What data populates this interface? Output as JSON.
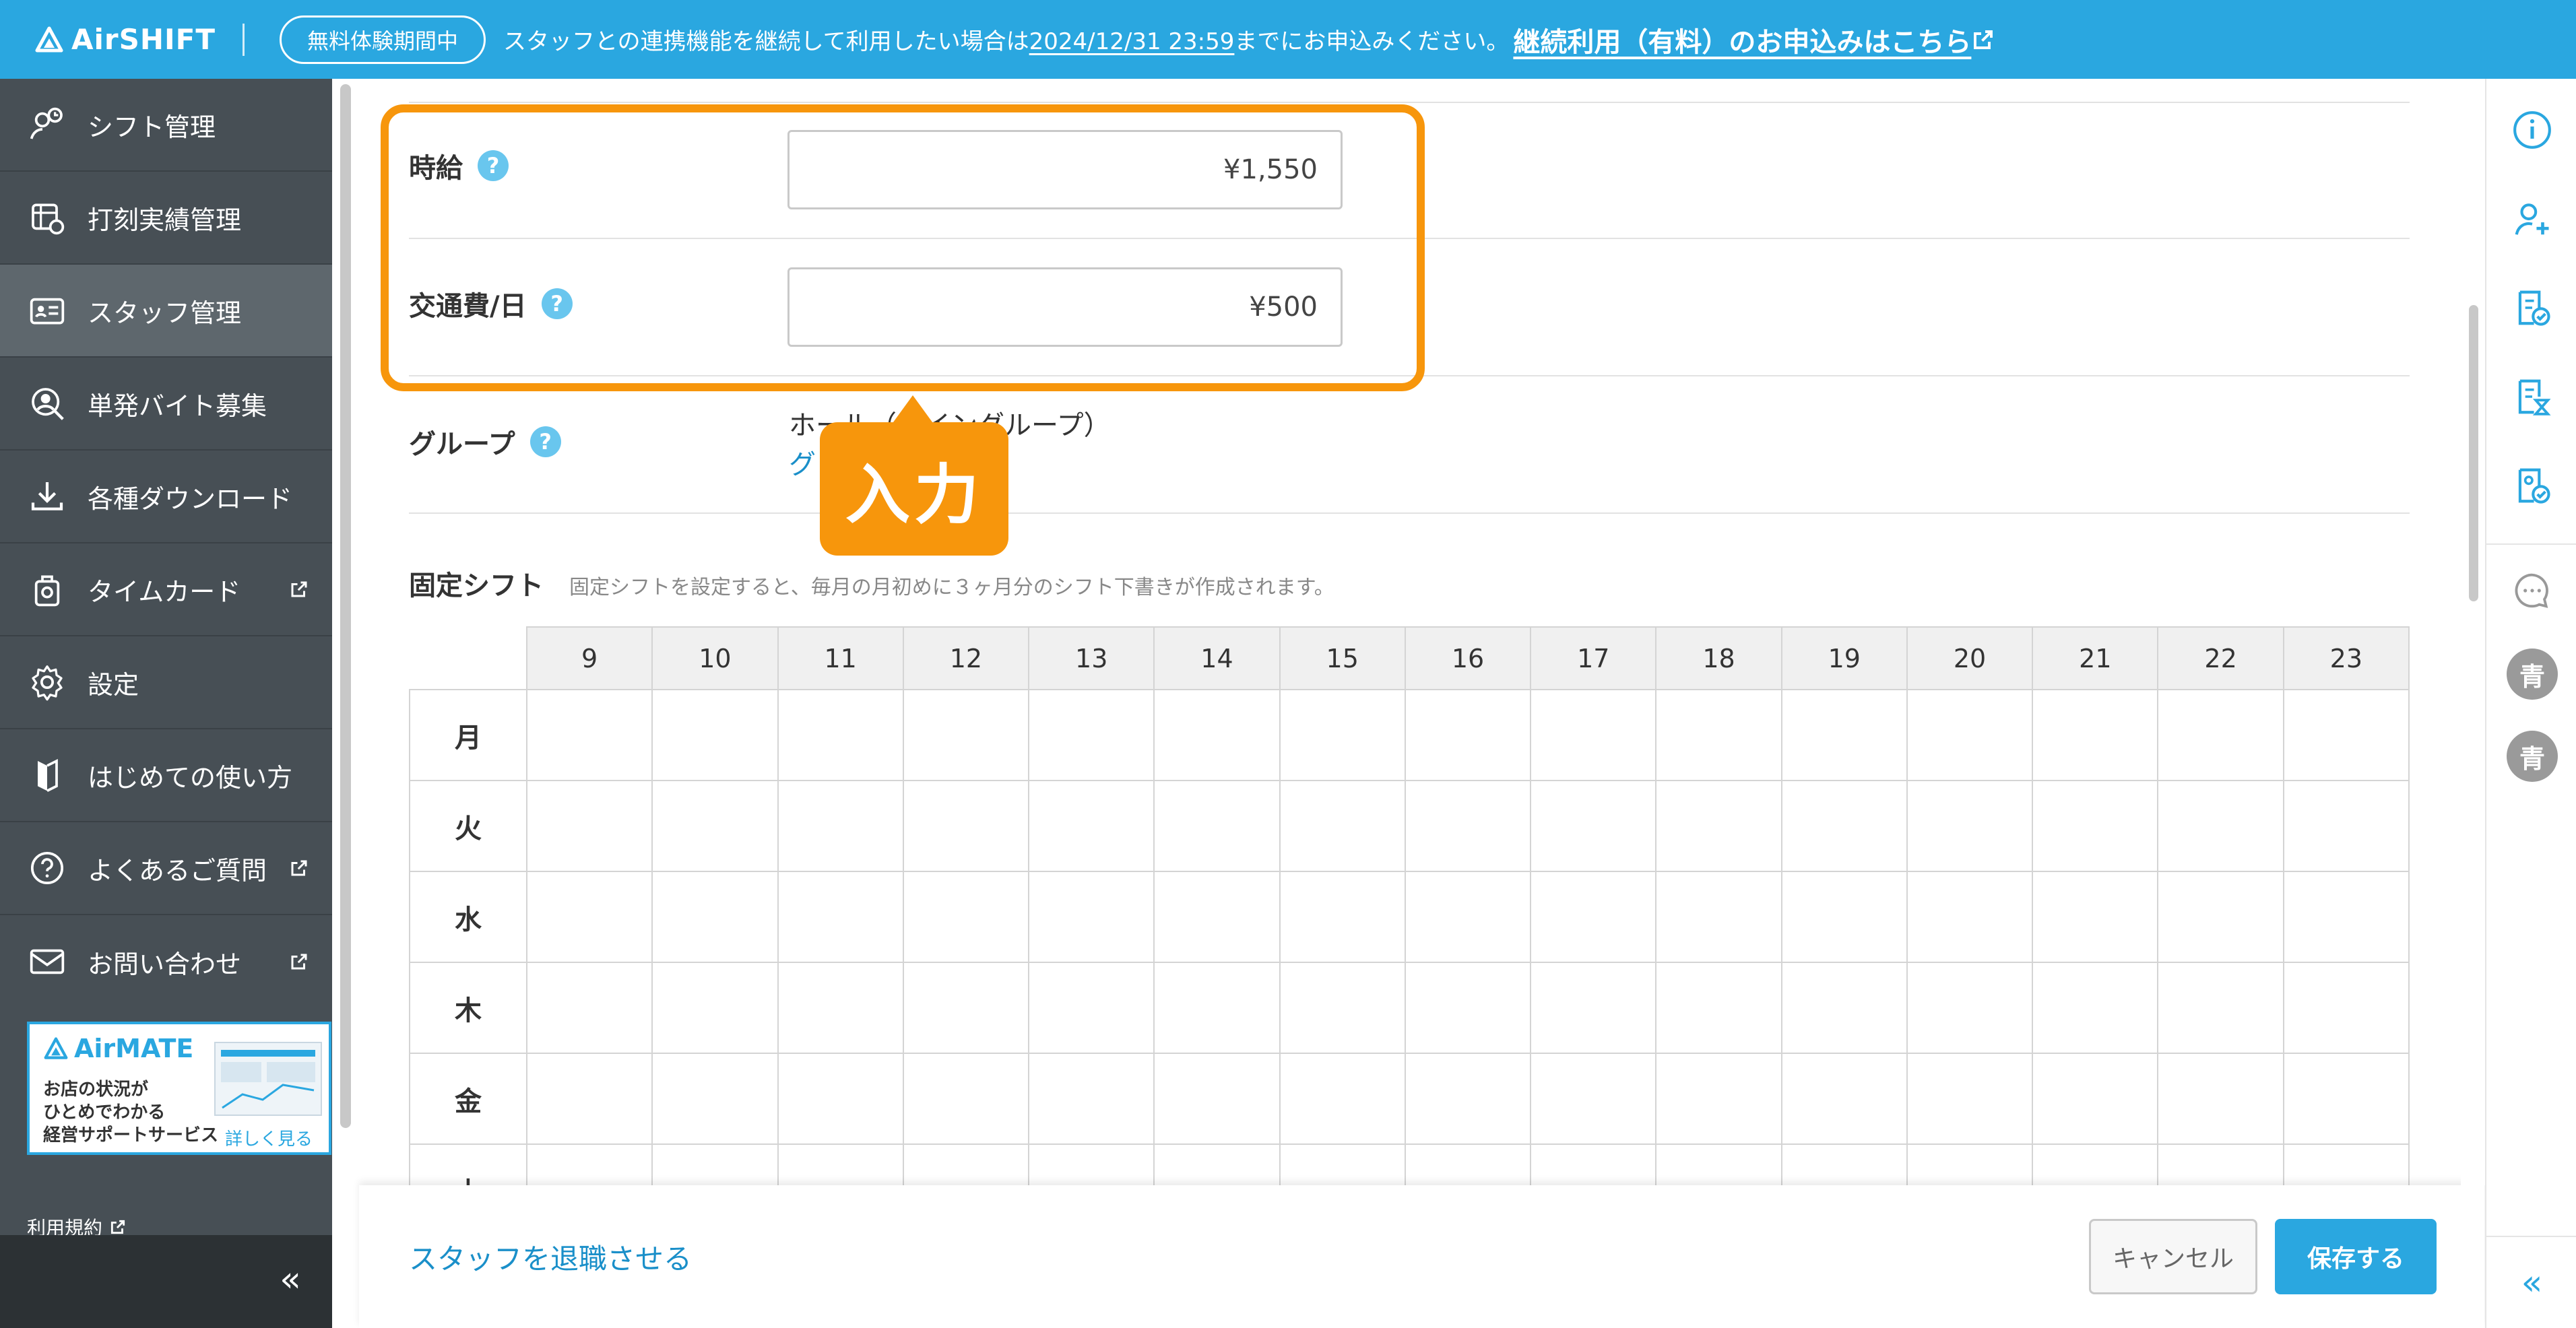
{
  "header": {
    "logo": "AirSHIFT",
    "trial_badge": "無料体験期間中",
    "banner_prefix": "スタッフとの連携機能を継続して利用したい場合は",
    "banner_date": "2024/12/31 23:59",
    "banner_suffix": "までにお申込みください。",
    "banner_link": "継続利用（有料）のお申込みはこちら"
  },
  "sidebar": {
    "items": [
      {
        "label": "シフト管理",
        "icon": "shift-icon"
      },
      {
        "label": "打刻実績管理",
        "icon": "timesheet-icon"
      },
      {
        "label": "スタッフ管理",
        "icon": "staff-icon",
        "active": true
      },
      {
        "label": "単発バイト募集",
        "icon": "recruit-icon"
      },
      {
        "label": "各種ダウンロード",
        "icon": "download-icon"
      },
      {
        "label": "タイムカード",
        "icon": "timecard-icon",
        "external": true
      },
      {
        "label": "設定",
        "icon": "gear-icon"
      },
      {
        "label": "はじめての使い方",
        "icon": "guide-icon"
      },
      {
        "label": "よくあるご質問",
        "icon": "question-icon",
        "external": true
      },
      {
        "label": "お問い合わせ",
        "icon": "mail-icon",
        "external": true
      }
    ],
    "ad": {
      "title": "AirMATE",
      "desc_line1": "お店の状況が",
      "desc_line2": "ひとめでわかる",
      "desc_line3": "経営サポートサービス",
      "more": "詳しく見る"
    },
    "terms": "利用規約",
    "collapse": "«"
  },
  "form": {
    "hourly_label": "時給",
    "hourly_value": "¥1,550",
    "transport_label": "交通費/日",
    "transport_value": "¥500",
    "group_label": "グループ",
    "group_value": "ホール（メイングループ）",
    "group_link": "グ",
    "callout": "入力"
  },
  "fixed_shift": {
    "title": "固定シフト",
    "desc": "固定シフトを設定すると、毎月の月初めに３ヶ月分のシフト下書きが作成されます。",
    "hours": [
      "9",
      "10",
      "11",
      "12",
      "13",
      "14",
      "15",
      "16",
      "17",
      "18",
      "19",
      "20",
      "21",
      "22",
      "23"
    ],
    "days": [
      "月",
      "火",
      "水",
      "木",
      "金",
      "土"
    ]
  },
  "footer": {
    "resign": "スタッフを退職させる",
    "cancel": "キャンセル",
    "save": "保存する"
  },
  "rail": {
    "avatar_1": "青",
    "avatar_2": "青",
    "collapse": "«"
  },
  "colors": {
    "brand": "#2aa7e0",
    "highlight": "#f7960c",
    "sidebar": "#474f55"
  }
}
